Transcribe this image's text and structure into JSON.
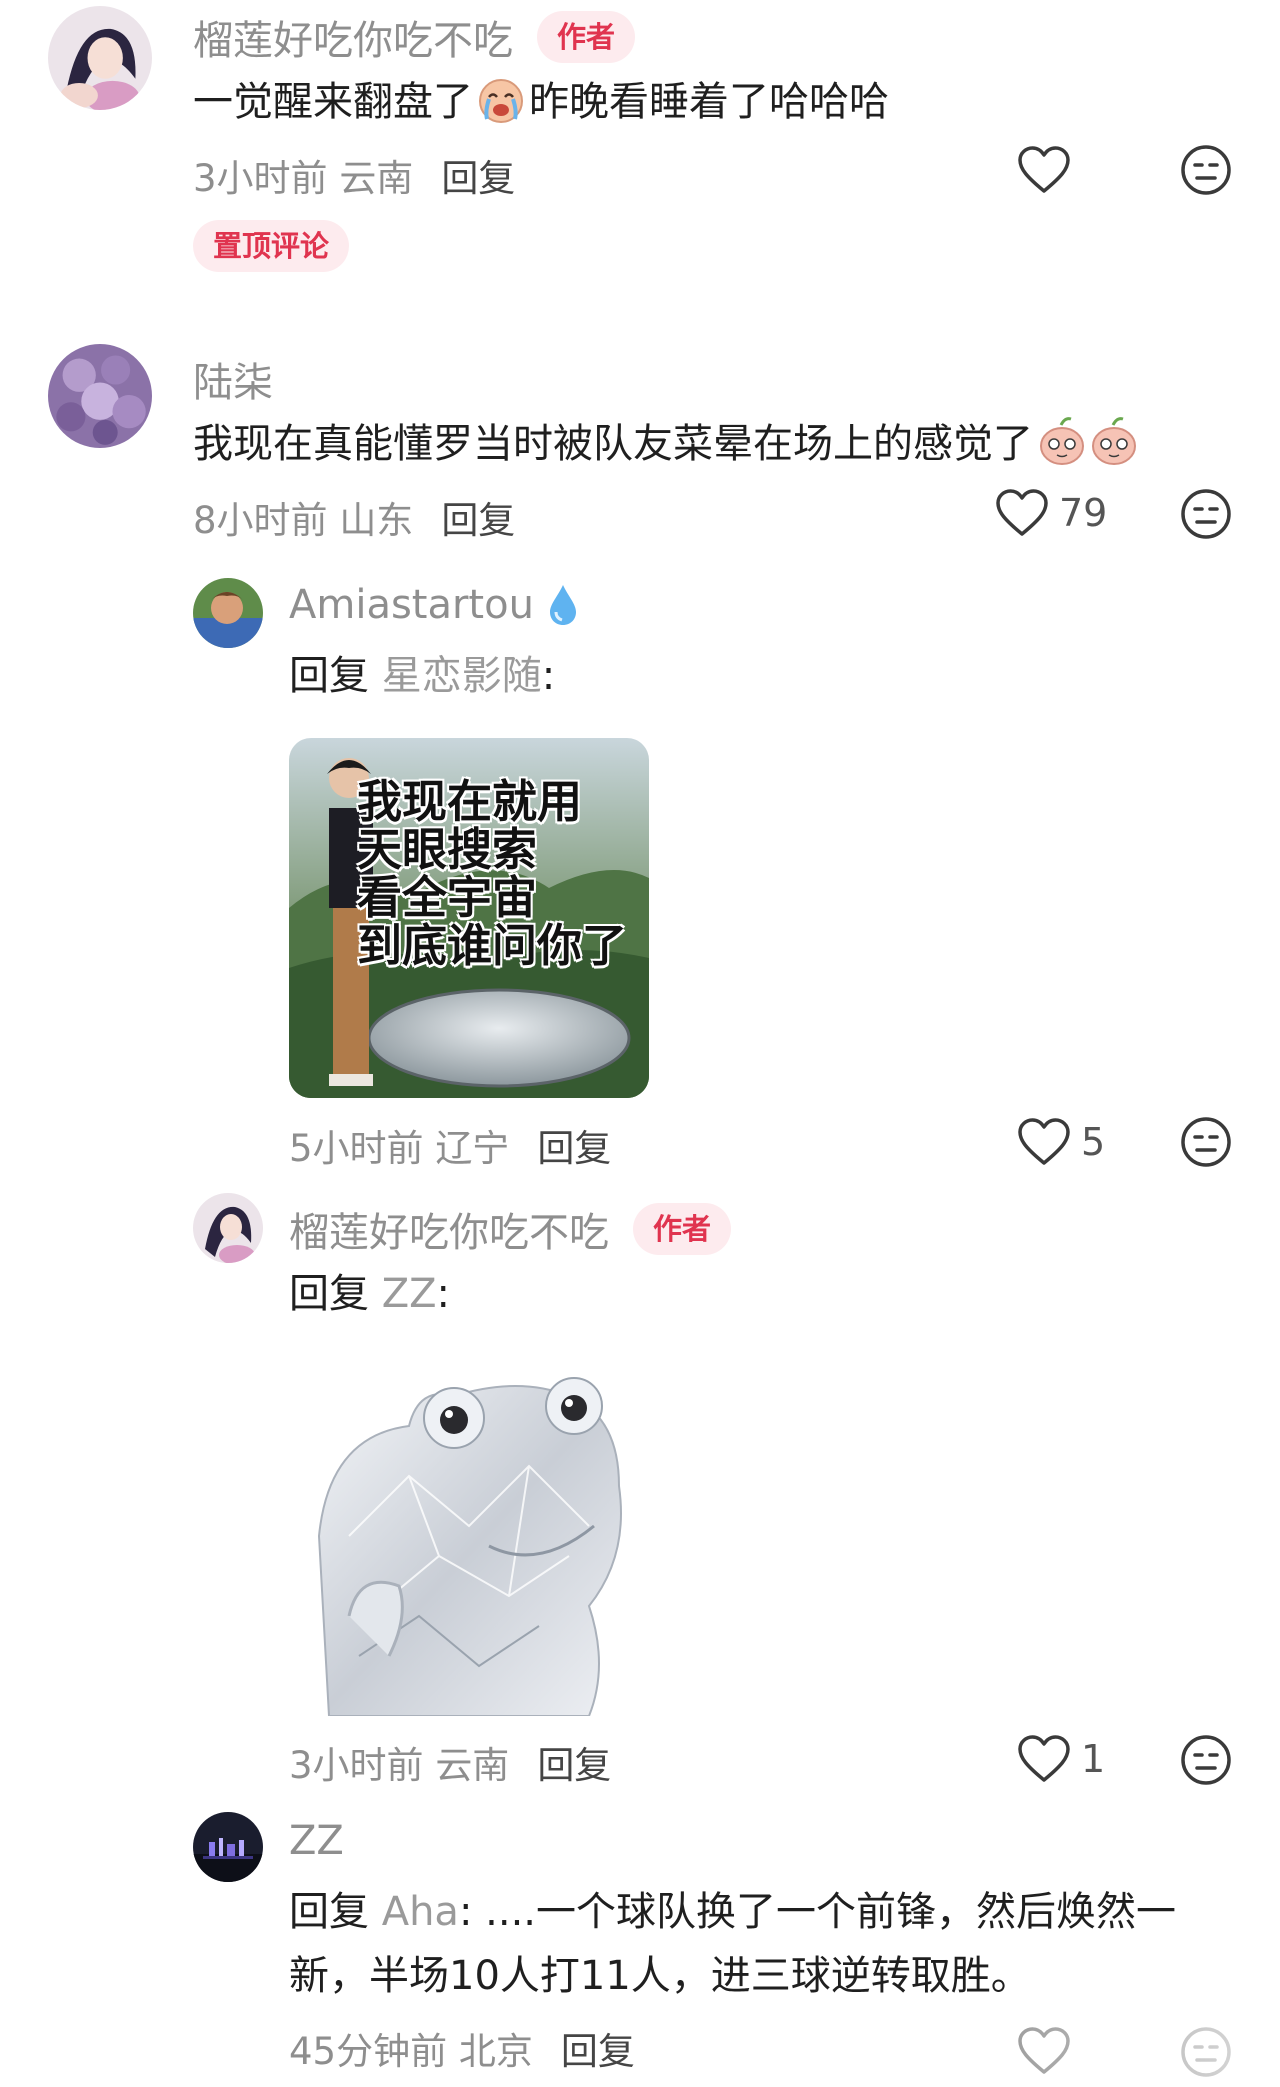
{
  "comments": [
    {
      "name": "榴莲好吃你吃不吃",
      "badge": "作者",
      "text_a": "一觉醒来翻盘了",
      "emoji": "crying-face-emoji",
      "text_b": "昨晚看睡着了哈哈哈",
      "time": "3小时前",
      "location": "云南",
      "reply_label": "回复",
      "pinned_label": "置顶评论"
    },
    {
      "name": "陆柒",
      "text": "我现在真能懂罗当时被队友菜晕在场上的感觉了",
      "emoji": "dizzy-peach-emoji",
      "time": "8小时前",
      "location": "山东",
      "reply_label": "回复",
      "likes": "79"
    }
  ],
  "replies": [
    {
      "name": "Amiastartou",
      "name_icon": "water-drop-icon",
      "reply_prefix": "回复",
      "reply_to": "星恋影随",
      "colon": ":",
      "meme_text": [
        "我现在就用",
        "天眼搜索",
        "看全宇宙",
        "到底谁问你了"
      ],
      "time": "5小时前",
      "location": "辽宁",
      "reply_label": "回复",
      "likes": "5"
    },
    {
      "name": "榴莲好吃你吃不吃",
      "badge": "作者",
      "reply_prefix": "回复",
      "reply_to": "ZZ",
      "colon": ":",
      "image": "crystal-frog-sticker",
      "time": "3小时前",
      "location": "云南",
      "reply_label": "回复",
      "likes": "1"
    },
    {
      "name": "ZZ",
      "reply_prefix": "回复",
      "reply_to": "Aha",
      "line1": ": ....一个球队换了一个前锋，然后焕然一",
      "line2": "新，半场10人打11人，进三球逆转取胜。",
      "time": "45分钟前",
      "location": "北京",
      "reply_label": "回复"
    }
  ],
  "colors": {
    "badge_text": "#e0344f",
    "badge_bg": "#fdebee",
    "secondary_text": "#8e8e8e"
  }
}
